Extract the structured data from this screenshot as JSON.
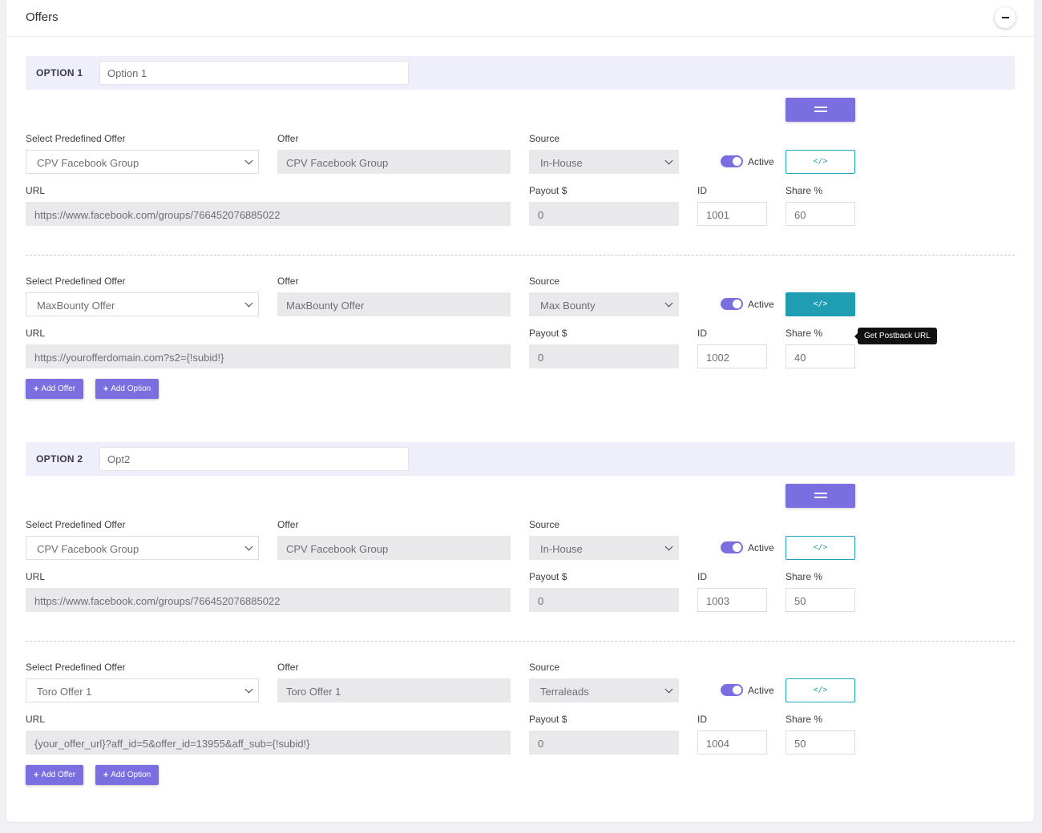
{
  "card": {
    "title": "Offers"
  },
  "labels": {
    "select_offer": "Select Predefined Offer",
    "offer": "Offer",
    "source": "Source",
    "url": "URL",
    "payout": "Payout $",
    "id": "ID",
    "share": "Share %",
    "active": "Active"
  },
  "buttons": {
    "code": "</>",
    "add_offer": "Add Offer",
    "add_option": "Add Option"
  },
  "tooltip": "Get Postback URL",
  "options": [
    {
      "label": "OPTION 1",
      "name": "Option 1",
      "offers": [
        {
          "predefined": "CPV Facebook Group",
          "offer": "CPV Facebook Group",
          "source": "In-House",
          "url": "https://www.facebook.com/groups/766452076885022",
          "payout": "0",
          "id": "1001",
          "share": "60",
          "active": true
        },
        {
          "predefined": "MaxBounty Offer",
          "offer": "MaxBounty Offer",
          "source": "Max Bounty",
          "url": "https://yourofferdomain.com?s2={!subid!}",
          "payout": "0",
          "id": "1002",
          "share": "40",
          "active": true
        }
      ]
    },
    {
      "label": "OPTION 2",
      "name": "Opt2",
      "offers": [
        {
          "predefined": "CPV Facebook Group",
          "offer": "CPV Facebook Group",
          "source": "In-House",
          "url": "https://www.facebook.com/groups/766452076885022",
          "payout": "0",
          "id": "1003",
          "share": "50",
          "active": true
        },
        {
          "predefined": "Toro Offer 1",
          "offer": "Toro Offer 1",
          "source": "Terraleads",
          "url": "{your_offer_url}?aff_id=5&offer_id=13955&aff_sub={!subid!}",
          "payout": "0",
          "id": "1004",
          "share": "50",
          "active": true
        }
      ]
    }
  ],
  "colors": {
    "accent": "#7a6ee0",
    "info": "#1f9db3",
    "option_bar": "#efeefb"
  }
}
